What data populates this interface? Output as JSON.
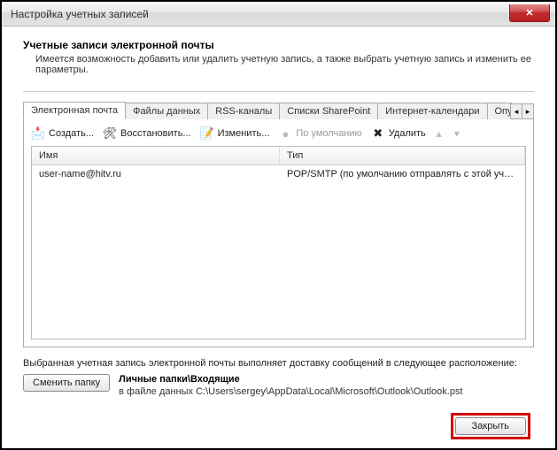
{
  "window": {
    "title": "Настройка учетных записей",
    "close_glyph": "✕"
  },
  "header": {
    "title": "Учетные записи электронной почты",
    "desc": "Имеется возможность добавить или удалить учетную запись, а также выбрать учетную запись и изменить ее параметры."
  },
  "tabs": {
    "items": [
      {
        "label": "Электронная почта"
      },
      {
        "label": "Файлы данных"
      },
      {
        "label": "RSS-каналы"
      },
      {
        "label": "Списки SharePoint"
      },
      {
        "label": "Интернет-календари"
      },
      {
        "label": "Опубликован"
      }
    ],
    "left_glyph": "◂",
    "right_glyph": "▸"
  },
  "toolbar": {
    "create": "Создать...",
    "restore": "Восстановить...",
    "edit": "Изменить...",
    "default": "По умолчанию",
    "delete": "Удалить",
    "up_glyph": "▴",
    "down_glyph": "▾"
  },
  "listview": {
    "col_name": "Имя",
    "col_type": "Тип",
    "rows": [
      {
        "name": "user-name@hitv.ru",
        "type": "POP/SMTP (по умолчанию отправлять с этой учет..."
      }
    ]
  },
  "bottom": {
    "info": "Выбранная учетная запись электронной почты выполняет доставку сообщений в следующее расположение:",
    "change_folder": "Сменить папку",
    "folder_title": "Личные папки\\Входящие",
    "folder_path": "в файле данных C:\\Users\\sergey\\AppData\\Local\\Microsoft\\Outlook\\Outlook.pst"
  },
  "footer": {
    "close": "Закрыть"
  }
}
